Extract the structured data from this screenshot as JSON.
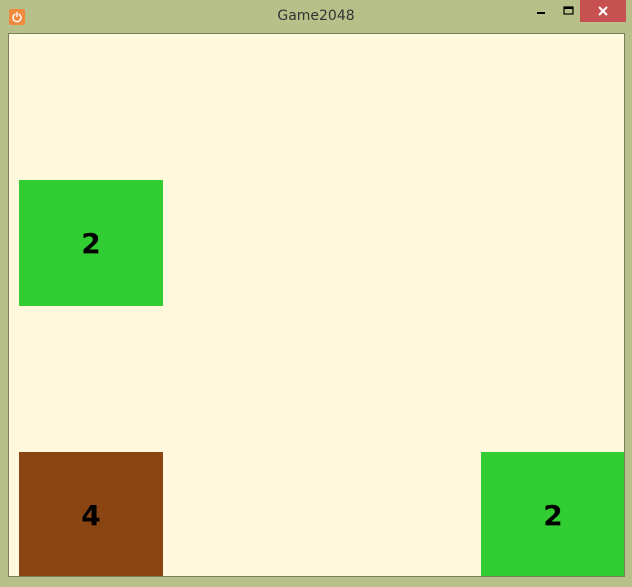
{
  "window": {
    "title": "Game2048",
    "app_icon": "power-icon",
    "controls": {
      "minimize_icon": "minimize-icon",
      "maximize_icon": "maximize-icon",
      "close_icon": "close-icon",
      "close_color": "#c75050"
    }
  },
  "board": {
    "background": "#fff8dd",
    "tiles": [
      {
        "value": "2",
        "color": "#32cd32"
      },
      {
        "value": "4",
        "color": "#8b4513"
      },
      {
        "value": "2",
        "color": "#32cd32"
      }
    ]
  }
}
